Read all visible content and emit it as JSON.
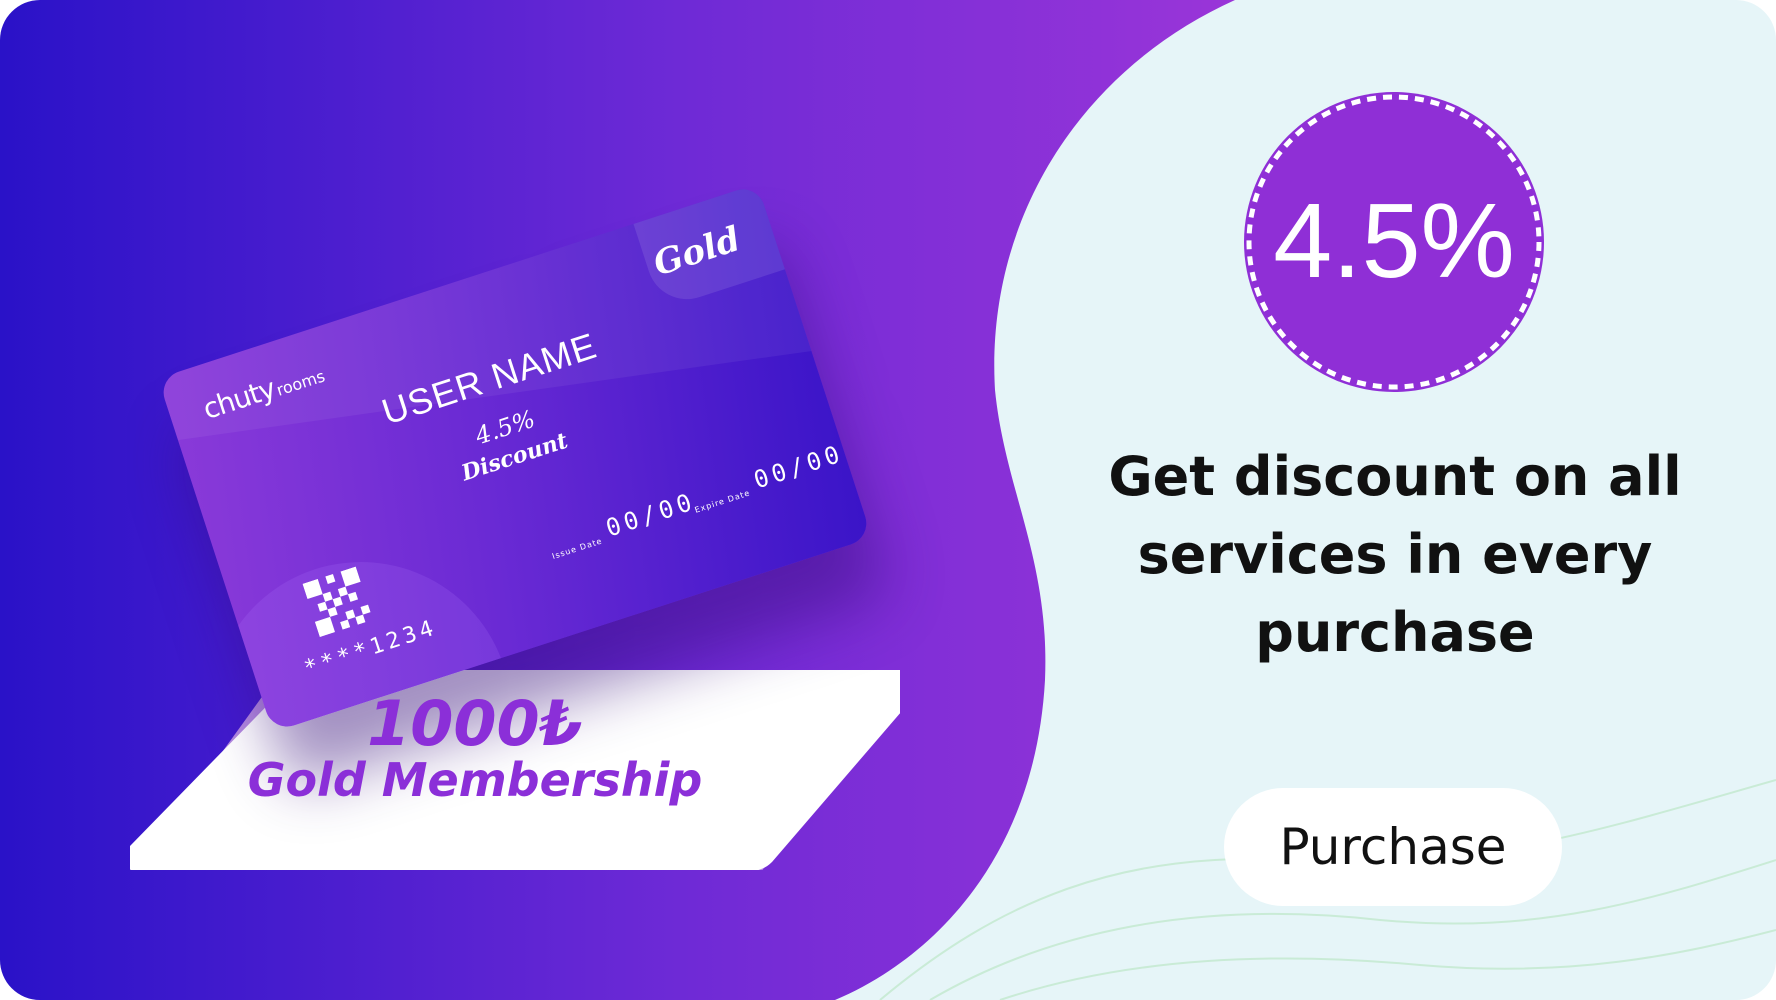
{
  "card": {
    "brand": "chuty",
    "brand_suffix": "rooms",
    "tier": "Gold",
    "user_name": "USER NAME",
    "discount_value": "4.5%",
    "discount_word": "Discount",
    "card_number": "****1234",
    "issue_label": "Issue Date",
    "issue_value": "00/00",
    "expire_label": "Expire Date",
    "expire_value": "00/00"
  },
  "offer": {
    "price": "1000₺",
    "plan": "Gold Membership",
    "badge": "4.5%",
    "tagline": "Get discount on all services in every purchase",
    "cta": "Purchase"
  },
  "colors": {
    "purple_start": "#2a12c8",
    "purple_end": "#9a35d8",
    "badge": "#8f2fd6",
    "panel": "#e6f5f8",
    "text_purple": "#8b2fd8"
  },
  "icons": {
    "qr": "qr-code-icon",
    "badge_edge": "stamp-badge-icon"
  }
}
